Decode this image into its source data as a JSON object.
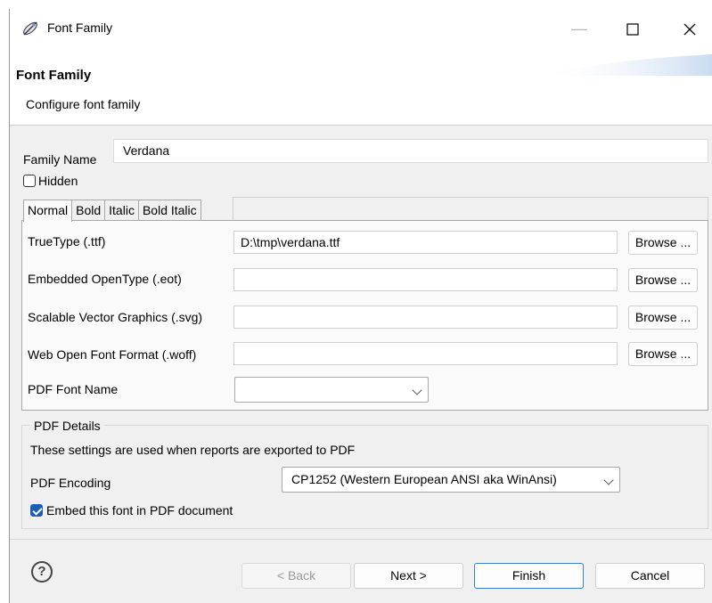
{
  "window": {
    "title": "Font Family",
    "accent": "#1a5fb4"
  },
  "header": {
    "title": "Font Family",
    "subtitle": "Configure font family"
  },
  "family": {
    "label": "Family Name",
    "value": "Verdana"
  },
  "hidden": {
    "label": "Hidden",
    "checked": false
  },
  "tabs": [
    "Normal",
    "Bold",
    "Italic",
    "Bold Italic"
  ],
  "active_tab": "Normal",
  "fonts": [
    {
      "label": "TrueType (.ttf)",
      "value": "D:\\tmp\\verdana.ttf",
      "button": "Browse ..."
    },
    {
      "label": "Embedded OpenType (.eot)",
      "value": "",
      "button": "Browse ..."
    },
    {
      "label": "Scalable Vector Graphics (.svg)",
      "value": "",
      "button": "Browse ..."
    },
    {
      "label": "Web Open Font Format (.woff)",
      "value": "",
      "button": "Browse ..."
    }
  ],
  "pdf_font_name": {
    "label": "PDF Font Name",
    "value": ""
  },
  "pdf_details": {
    "title": "PDF Details",
    "description": "These settings are used when reports are exported to PDF",
    "encoding_label": "PDF Encoding",
    "encoding_value": "CP1252 (Western European ANSI aka WinAnsi)",
    "embed_label": "Embed this font in PDF document",
    "embed_checked": true
  },
  "footer": {
    "help": "?",
    "back": "< Back",
    "next": "Next >",
    "finish": "Finish",
    "cancel": "Cancel"
  }
}
